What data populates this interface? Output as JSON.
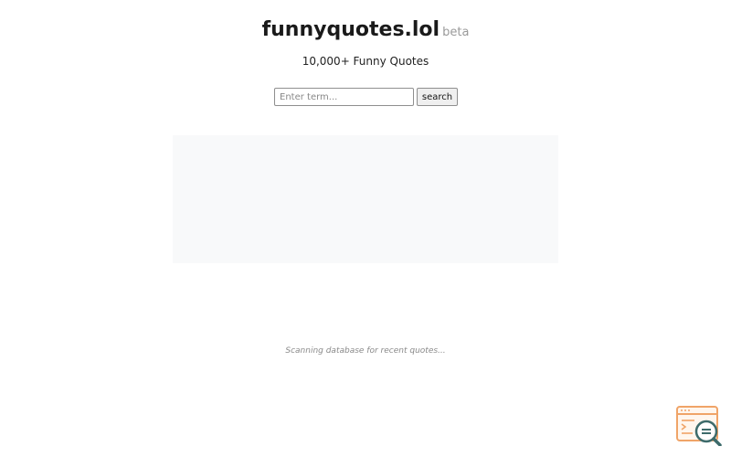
{
  "header": {
    "title": "funnyquotes.lol",
    "badge": "beta"
  },
  "tagline": "10,000+ Funny Quotes",
  "search": {
    "placeholder": "Enter term...",
    "value": "",
    "button_label": "search"
  },
  "status_text": "Scanning database for recent quotes...",
  "widget": {
    "icon": "browser-search-icon",
    "accent_color": "#f0a468",
    "magnifier_color": "#3d6b6b"
  }
}
